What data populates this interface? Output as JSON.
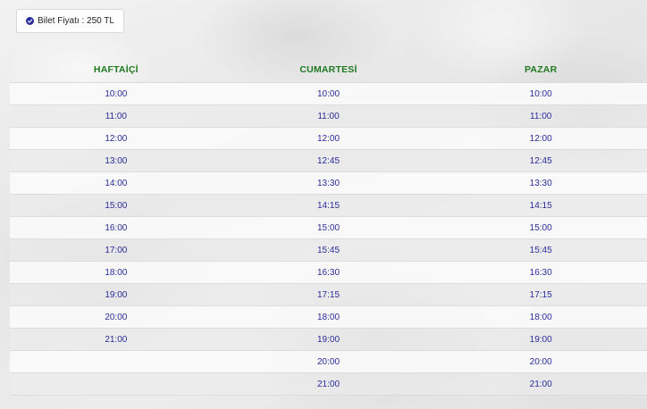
{
  "price": {
    "label": "Bilet Fiyatı : 250 TL",
    "icon": "check-circle-icon"
  },
  "colors": {
    "header_text": "#1f7a1f",
    "time_text": "#2b2b9b",
    "icon": "#2a2aa0"
  },
  "columns": [
    "HAFTAİÇİ",
    "CUMARTESİ",
    "PAZAR"
  ],
  "rows": [
    [
      "10:00",
      "10:00",
      "10:00"
    ],
    [
      "11:00",
      "11:00",
      "11:00"
    ],
    [
      "12:00",
      "12:00",
      "12:00"
    ],
    [
      "13:00",
      "12:45",
      "12:45"
    ],
    [
      "14:00",
      "13:30",
      "13:30"
    ],
    [
      "15:00",
      "14:15",
      "14:15"
    ],
    [
      "16:00",
      "15:00",
      "15:00"
    ],
    [
      "17:00",
      "15:45",
      "15:45"
    ],
    [
      "18:00",
      "16:30",
      "16:30"
    ],
    [
      "19:00",
      "17:15",
      "17:15"
    ],
    [
      "20:00",
      "18:00",
      "18:00"
    ],
    [
      "21:00",
      "19:00",
      "19:00"
    ],
    [
      "",
      "20:00",
      "20:00"
    ],
    [
      "",
      "21:00",
      "21:00"
    ]
  ]
}
